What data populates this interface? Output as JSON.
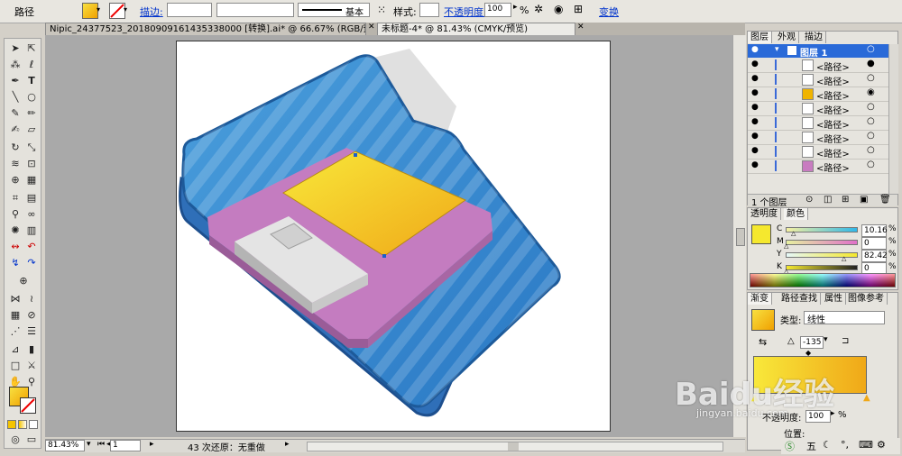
{
  "control_bar": {
    "selection_label": "路径",
    "stroke_label": "描边:",
    "brush_label": "基本",
    "style_label": "样式:",
    "opacity_label": "不透明度:",
    "opacity_value": "100",
    "percent": "%",
    "transform_label": "变换"
  },
  "tabs": [
    {
      "label": "Nipic_24377523_20180909161435338000 [转换].ai* @ 66.67% (RGB/预览)"
    },
    {
      "label": "未标题-4* @ 81.43% (CMYK/预览)"
    }
  ],
  "status": {
    "zoom": "81.43%",
    "page": "1",
    "message": "43 次还原：无重做"
  },
  "layers_panel": {
    "tabs": [
      "图层",
      "外观",
      "描边"
    ],
    "layer_name": "图层 1",
    "rows": [
      "<路径>",
      "<路径>",
      "<路径>",
      "<路径>",
      "<路径>",
      "<路径>",
      "<路径>",
      "<路径>"
    ],
    "footer": "1 个图层"
  },
  "color_panel": {
    "tabs": [
      "透明度",
      "颜色"
    ],
    "channels": [
      {
        "name": "C",
        "value": "10.16",
        "level": 0.1
      },
      {
        "name": "M",
        "value": "0",
        "level": 0.0
      },
      {
        "name": "Y",
        "value": "82.42",
        "level": 0.82
      },
      {
        "name": "K",
        "value": "0",
        "level": 0.0
      }
    ],
    "percent": "%"
  },
  "gradient_panel": {
    "tabs": [
      "渐变",
      "路径查找",
      "属性",
      "图像参考"
    ],
    "type_label": "类型:",
    "type_value": "线性",
    "angle": "-135",
    "opacity_label": "不透明度:",
    "opacity_value": "100",
    "location_label": "位置:",
    "percent": "%"
  },
  "watermark": {
    "text": "Baidu经验",
    "sub": "jingyan.baidu.com"
  },
  "colors": {
    "fill": "#f5d416",
    "accent": "#1c5fc9",
    "folder": "#3a8fd0",
    "disk": "#c87cc0"
  }
}
